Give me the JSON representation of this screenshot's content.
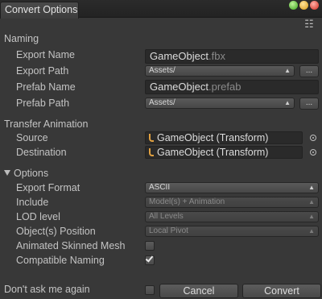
{
  "window": {
    "tab_title": "Convert Options"
  },
  "naming": {
    "section_label": "Naming",
    "export_name_label": "Export Name",
    "export_name_base": "GameObject",
    "export_name_ext": ".fbx",
    "export_path_label": "Export Path",
    "export_path_value": "Assets/",
    "prefab_name_label": "Prefab Name",
    "prefab_name_base": "GameObject",
    "prefab_name_ext": ".prefab",
    "prefab_path_label": "Prefab Path",
    "prefab_path_value": "Assets/",
    "browse_label": "..."
  },
  "transfer_animation": {
    "section_label": "Transfer Animation",
    "source_label": "Source",
    "source_value": "GameObject (Transform)",
    "destination_label": "Destination",
    "destination_value": "GameObject (Transform)"
  },
  "options": {
    "section_label": "Options",
    "export_format_label": "Export Format",
    "export_format_value": "ASCII",
    "include_label": "Include",
    "include_value": "Model(s) + Animation",
    "lod_level_label": "LOD level",
    "lod_level_value": "All Levels",
    "object_position_label": "Object(s) Position",
    "object_position_value": "Local Pivot",
    "animated_skinned_mesh_label": "Animated Skinned Mesh",
    "animated_skinned_mesh_checked": false,
    "compatible_naming_label": "Compatible Naming",
    "compatible_naming_checked": true
  },
  "footer": {
    "dont_ask_label": "Don't ask me again",
    "dont_ask_checked": false,
    "cancel_label": "Cancel",
    "convert_label": "Convert"
  }
}
